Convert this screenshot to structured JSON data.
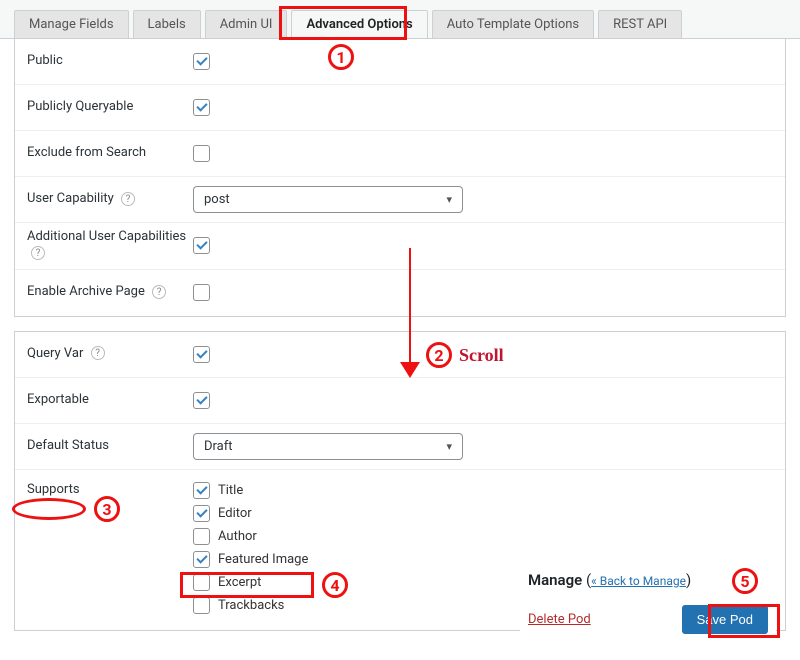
{
  "tabs": [
    {
      "label": "Manage Fields"
    },
    {
      "label": "Labels"
    },
    {
      "label": "Admin UI"
    },
    {
      "label": "Advanced Options"
    },
    {
      "label": "Auto Template Options"
    },
    {
      "label": "REST API"
    }
  ],
  "section_top": {
    "public": {
      "label": "Public",
      "checked": true
    },
    "publicly_queryable": {
      "label": "Publicly Queryable",
      "checked": true
    },
    "exclude_search": {
      "label": "Exclude from Search",
      "checked": false
    },
    "user_capability": {
      "label": "User Capability",
      "value": "post"
    },
    "addl_caps": {
      "label": "Additional User Capabilities",
      "checked": true
    },
    "archive": {
      "label": "Enable Archive Page",
      "checked": false
    }
  },
  "section_bottom": {
    "query_var": {
      "label": "Query Var",
      "checked": true
    },
    "exportable": {
      "label": "Exportable",
      "checked": true
    },
    "default_status": {
      "label": "Default Status",
      "value": "Draft"
    },
    "supports_label": "Supports",
    "supports": [
      {
        "label": "Title",
        "checked": true
      },
      {
        "label": "Editor",
        "checked": true
      },
      {
        "label": "Author",
        "checked": false
      },
      {
        "label": "Featured Image",
        "checked": true
      },
      {
        "label": "Excerpt",
        "checked": false
      },
      {
        "label": "Trackbacks",
        "checked": false
      }
    ]
  },
  "manage": {
    "title": "Manage",
    "back_link": "« Back to Manage",
    "delete": "Delete Pod",
    "save": "Save Pod"
  },
  "help_glyph": "?",
  "annotations": {
    "n1": "1",
    "n2": "2",
    "scroll": "Scroll",
    "n3": "3",
    "n4": "4",
    "n5": "5"
  }
}
